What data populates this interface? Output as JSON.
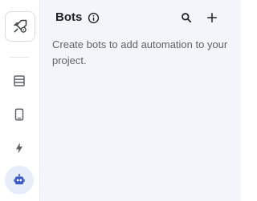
{
  "rail": {
    "logo_icon": "rocket-settings-icon",
    "items": [
      {
        "name": "table-icon"
      },
      {
        "name": "mobile-icon"
      },
      {
        "name": "lightning-icon"
      },
      {
        "name": "bot-icon",
        "active": true
      }
    ]
  },
  "panel": {
    "title": "Bots",
    "info_icon": "info-icon",
    "search_icon": "search-icon",
    "add_icon": "add-icon",
    "description": "Create bots to add automation to your project."
  },
  "colors": {
    "panel_bg": "#f3f5fb",
    "active_bg": "#e8edfb",
    "active_icon": "#3b5cc7",
    "icon_gray": "#5f6368"
  }
}
